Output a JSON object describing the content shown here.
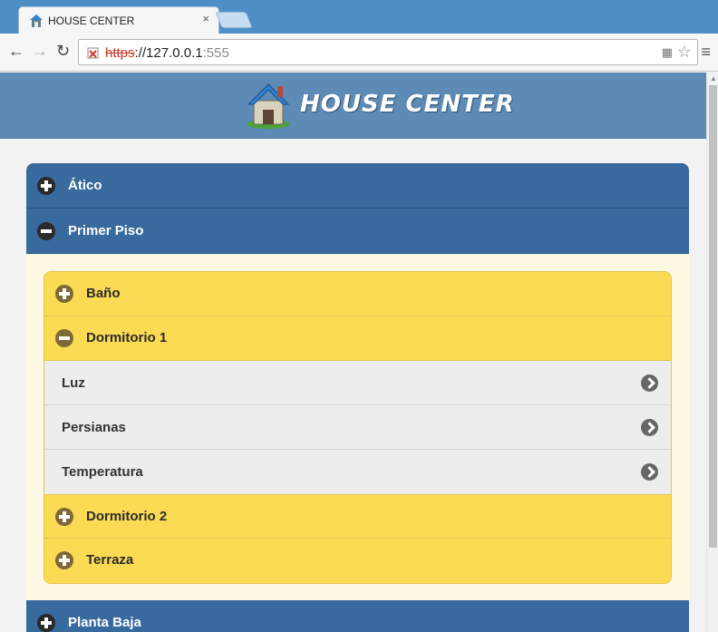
{
  "browser": {
    "tab_title": "HOUSE CENTER",
    "tab_close": "×",
    "url_protocol": "https",
    "url_rest": "://127.0.0.1",
    "url_port": ":555"
  },
  "app": {
    "title": "HOUSE CENTER"
  },
  "sections": [
    {
      "label": "Ático",
      "expanded": false
    },
    {
      "label": "Primer Piso",
      "expanded": true
    },
    {
      "label": "Planta Baja",
      "expanded": false
    }
  ],
  "rooms": [
    {
      "label": "Baño",
      "expanded": false
    },
    {
      "label": "Dormitorio 1",
      "expanded": true
    },
    {
      "label": "Dormitorio 2",
      "expanded": false
    },
    {
      "label": "Terraza",
      "expanded": false
    }
  ],
  "devices": [
    {
      "label": "Luz"
    },
    {
      "label": "Persianas"
    },
    {
      "label": "Temperatura"
    }
  ],
  "colors": {
    "header_bg": "#5e8bb5",
    "section_bg": "#386a9d",
    "room_bg": "#fbdb53",
    "body_bg": "#fff8e2"
  }
}
